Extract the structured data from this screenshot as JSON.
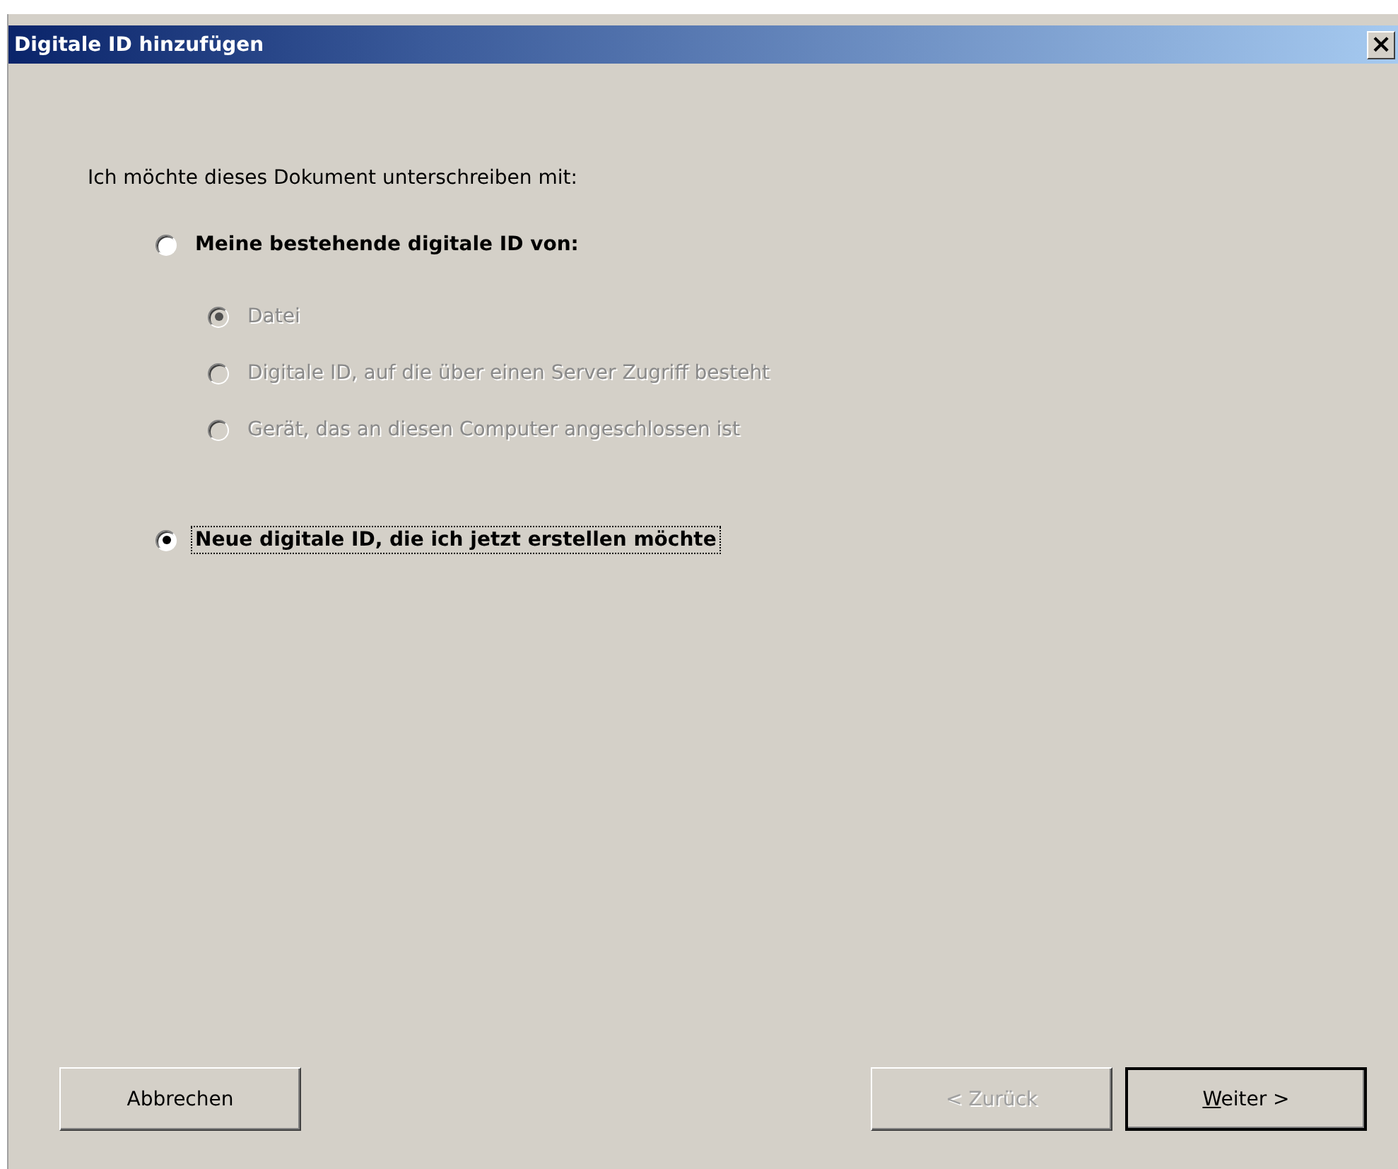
{
  "window": {
    "title": "Digitale ID hinzufügen",
    "close_icon": "×"
  },
  "prompt": "Ich möchte dieses Dokument unterschreiben mit:",
  "options": [
    {
      "label": "Meine bestehende digitale ID von:",
      "selected": false,
      "focused": false,
      "children": [
        {
          "label": "Datei",
          "selected": true,
          "disabled": true
        },
        {
          "label": "Digitale ID, auf die über einen Server Zugriff besteht",
          "selected": false,
          "disabled": true
        },
        {
          "label": "Gerät, das an diesen Computer angeschlossen ist",
          "selected": false,
          "disabled": true
        }
      ]
    },
    {
      "label": "Neue digitale ID, die ich jetzt erstellen möchte",
      "selected": true,
      "focused": true
    }
  ],
  "buttons": [
    {
      "label_parts": [
        {
          "text": "Abbrechen",
          "underlined": false
        }
      ],
      "disabled": false,
      "default": false
    },
    {
      "label_parts": [
        {
          "text": "< Zurück",
          "underlined": false
        }
      ],
      "disabled": true,
      "default": false
    },
    {
      "label_parts": [
        {
          "text": "W",
          "underlined": true
        },
        {
          "text": "eiter >",
          "underlined": false
        }
      ],
      "disabled": false,
      "default": true
    }
  ]
}
